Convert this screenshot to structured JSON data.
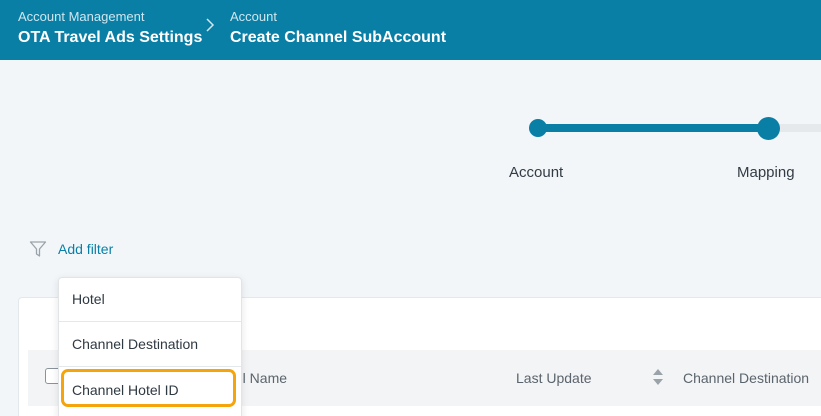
{
  "header": {
    "breadcrumbs": [
      {
        "section": "Account Management",
        "title": "OTA Travel Ads Settings"
      },
      {
        "section": "Account",
        "title": "Create Channel SubAccount"
      }
    ]
  },
  "stepper": {
    "steps": [
      "Account",
      "Mapping"
    ],
    "active_step": "Mapping"
  },
  "filter": {
    "add_filter_label": "Add filter",
    "options": [
      "Hotel",
      "Channel Destination",
      "Channel Hotel ID"
    ],
    "highlighted_option": "Channel Hotel ID"
  },
  "table": {
    "columns": [
      "tel Name",
      "Last Update",
      "Channel Destination"
    ]
  },
  "colors": {
    "brand": "#0a7fa6",
    "highlight": "#f5a40c"
  }
}
